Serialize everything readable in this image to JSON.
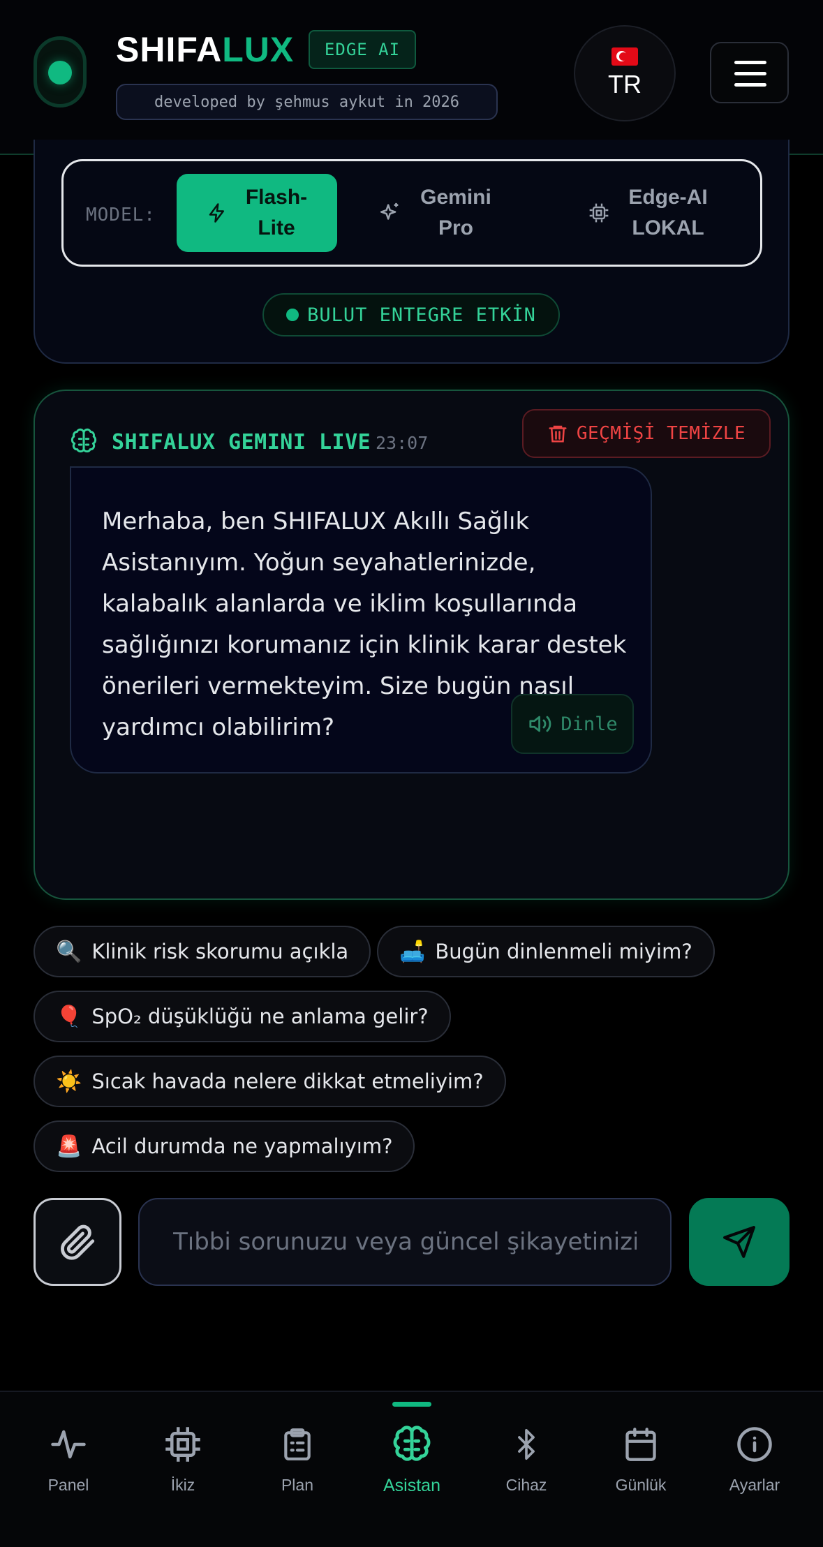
{
  "header": {
    "brand_part1": "SHIFA",
    "brand_part2": "LUX",
    "edge_badge": "EDGE AI",
    "developer": "developed by şehmus aykut in 2026",
    "language_code": "TR",
    "flag_icon": "turkey-flag-icon",
    "menu_icon": "hamburger-menu-icon"
  },
  "model_selector": {
    "label": "MODEL:",
    "options": [
      {
        "label": "Flash-\nLite",
        "icon": "lightning-icon",
        "active": true
      },
      {
        "label": "Gemini\nPro",
        "icon": "sparkles-icon",
        "active": false
      },
      {
        "label": "Edge-AI\nLOKAL",
        "icon": "cpu-chip-icon",
        "active": false
      }
    ],
    "status": "BULUT ENTEGRE ETKİN"
  },
  "chat": {
    "title": "SHIFALUX GEMINI LIVE",
    "time": "23:07",
    "clear_label": "GEÇMİŞİ TEMİZLE",
    "message": "Merhaba, ben SHIFALUX Akıllı Sağlık Asistanıyım. Yoğun seyahatlerinizde, kalabalık alanlarda ve iklim koşullarında sağlığınızı korumanız için klinik karar destek önerileri vermekteyim. Size bugün nasıl yardımcı olabilirim?",
    "listen_label": "Dinle"
  },
  "suggestions": [
    {
      "emoji": "🔍",
      "text": "Klinik risk skorumu açıkla"
    },
    {
      "emoji": "🛋️",
      "text": "Bugün dinlenmeli miyim?"
    },
    {
      "emoji": "🎈",
      "text": "SpO₂ düşüklüğü ne anlama gelir?"
    },
    {
      "emoji": "☀️",
      "text": "Sıcak havada nelere dikkat etmeliyim?"
    },
    {
      "emoji": "🚨",
      "text": "Acil durumda ne yapmalıyım?"
    }
  ],
  "input": {
    "placeholder": "Tıbbi sorunuzu veya güncel şikayetinizi",
    "value": ""
  },
  "nav": [
    {
      "label": "Panel",
      "icon": "activity-pulse-icon"
    },
    {
      "label": "İkiz",
      "icon": "cpu-chip-icon"
    },
    {
      "label": "Plan",
      "icon": "clipboard-list-icon"
    },
    {
      "label": "Asistan",
      "icon": "brain-icon",
      "active": true
    },
    {
      "label": "Cihaz",
      "icon": "bluetooth-icon"
    },
    {
      "label": "Günlük",
      "icon": "calendar-icon"
    },
    {
      "label": "Ayarlar",
      "icon": "info-circle-icon"
    }
  ],
  "colors": {
    "accent": "#10b981",
    "accent_text": "#34d399",
    "danger": "#ef4444",
    "background": "#000000"
  }
}
